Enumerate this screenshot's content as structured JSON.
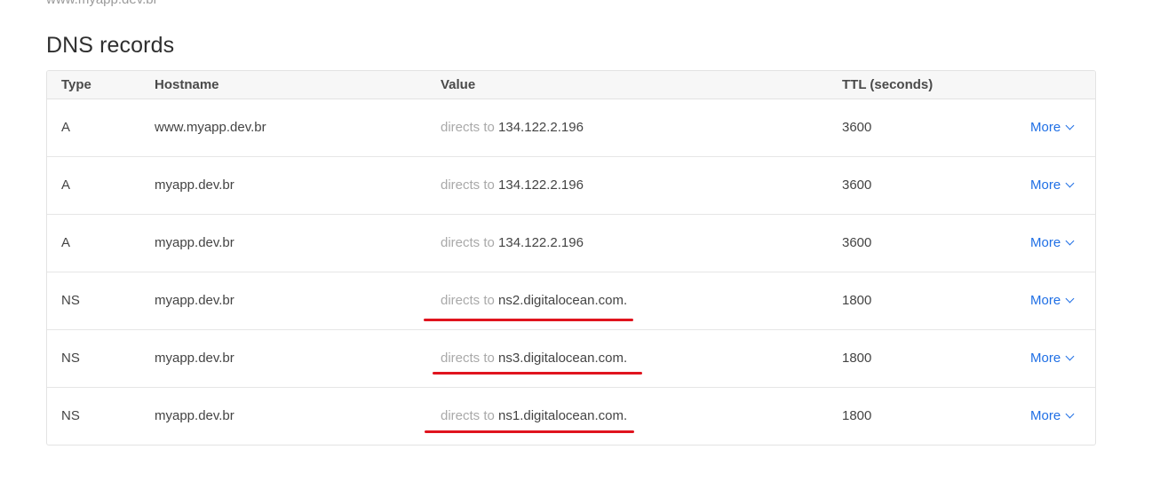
{
  "cut_text": "www.myapp.dev.br",
  "title": "DNS records",
  "headers": {
    "type": "Type",
    "hostname": "Hostname",
    "value": "Value",
    "ttl": "TTL (seconds)"
  },
  "directs_label": "directs to",
  "more_label": "More",
  "records": [
    {
      "type": "A",
      "hostname": "www.myapp.dev.br",
      "value": "134.122.2.196",
      "ttl": "3600"
    },
    {
      "type": "A",
      "hostname": "myapp.dev.br",
      "value": "134.122.2.196",
      "ttl": "3600"
    },
    {
      "type": "A",
      "hostname": "myapp.dev.br",
      "value": "134.122.2.196",
      "ttl": "3600"
    },
    {
      "type": "NS",
      "hostname": "myapp.dev.br",
      "value": "ns2.digitalocean.com.",
      "ttl": "1800"
    },
    {
      "type": "NS",
      "hostname": "myapp.dev.br",
      "value": "ns3.digitalocean.com.",
      "ttl": "1800"
    },
    {
      "type": "NS",
      "hostname": "myapp.dev.br",
      "value": "ns1.digitalocean.com.",
      "ttl": "1800"
    }
  ],
  "annotation_color": "#e0141e",
  "link_color": "#1f6fe5"
}
